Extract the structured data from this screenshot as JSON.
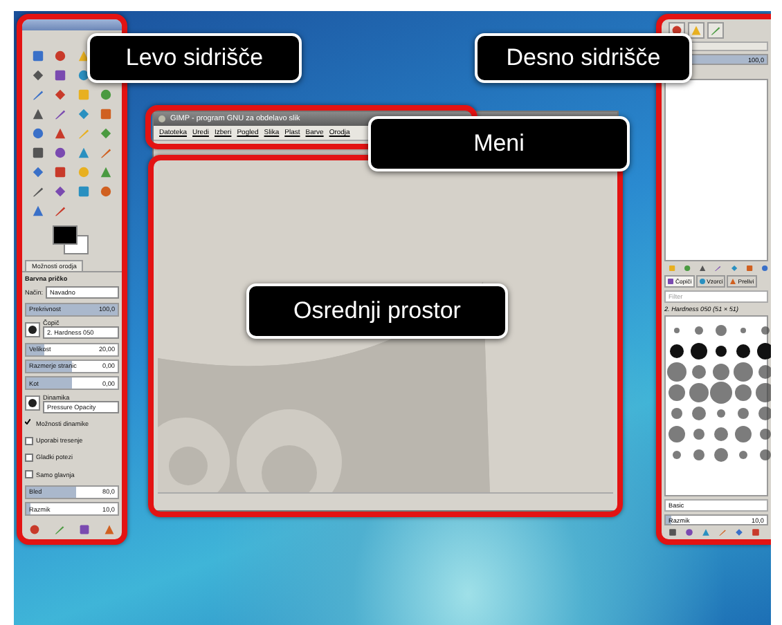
{
  "callouts": [
    {
      "text": "Levo sidrišče"
    },
    {
      "text": "Desno sidrišče"
    },
    {
      "text": "Meni"
    },
    {
      "text": "Osrednji prostor"
    }
  ],
  "window": {
    "title": "GIMP - program GNU za obdelavo slik",
    "menu": [
      "Datoteka",
      "Uredi",
      "Izberi",
      "Pogled",
      "Slika",
      "Plast",
      "Barve",
      "Orodja"
    ]
  },
  "left_dock": {
    "tab": "Možnosti orodja",
    "heading": "Barvna pričko",
    "options": [
      {
        "kind": "select",
        "label": "Način:",
        "value": "Navadno"
      },
      {
        "kind": "slider",
        "label": "Prekrivnost",
        "value": "100,0",
        "level": 1
      },
      {
        "kind": "preset",
        "label": "Čopič",
        "value": "2. Hardness 050"
      },
      {
        "kind": "slider",
        "label": "Velikost",
        "value": "20,00",
        "level": 0.2
      },
      {
        "kind": "slider",
        "label": "Razmerje stranic",
        "value": "0,00",
        "level": 0.5
      },
      {
        "kind": "slider",
        "label": "Kot",
        "value": "0,00",
        "level": 0.5
      },
      {
        "kind": "preset",
        "label": "Dinamika",
        "value": "Pressure Opacity"
      },
      {
        "kind": "check",
        "label": "Možnosti dinamike",
        "checked": true
      },
      {
        "kind": "check",
        "label": "Uporabi tresenje",
        "checked": false
      },
      {
        "kind": "check",
        "label": "Gladki potezi",
        "checked": false
      },
      {
        "kind": "check",
        "label": "Samo glavnja",
        "checked": false
      },
      {
        "kind": "slider",
        "label": "Bled",
        "value": "80,0",
        "level": 0.55
      },
      {
        "kind": "slider",
        "label": "Razmik",
        "value": "10,0",
        "level": 0.05
      }
    ]
  },
  "right_dock": {
    "opacity": {
      "value": "100,0",
      "level": 1
    },
    "brush_tabs": [
      {
        "label": "Čopiči",
        "selected": true
      },
      {
        "label": "Vzorci",
        "selected": false
      },
      {
        "label": "Prelivi",
        "selected": false
      }
    ],
    "filter_placeholder": "Filter",
    "brush_name": "2. Hardness 050 (51 × 51)",
    "tag": "Basic",
    "spacing": {
      "label": "Razmik",
      "value": "10,0",
      "level": 0.05
    }
  }
}
